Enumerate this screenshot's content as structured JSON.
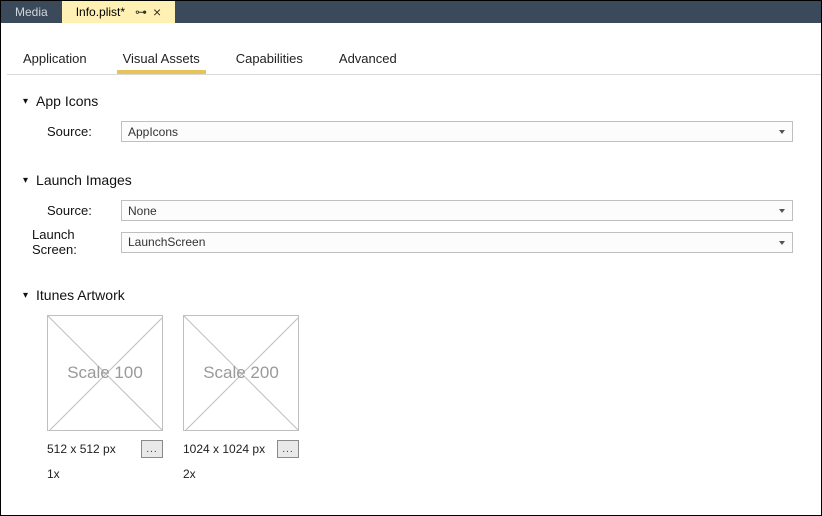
{
  "tabs": {
    "inactive": "Media",
    "active": "Info.plist*"
  },
  "subtabs": {
    "application": "Application",
    "visual_assets": "Visual Assets",
    "capabilities": "Capabilities",
    "advanced": "Advanced"
  },
  "sections": {
    "app_icons": {
      "title": "App Icons",
      "source_label": "Source:",
      "source_value": "AppIcons"
    },
    "launch_images": {
      "title": "Launch Images",
      "source_label": "Source:",
      "source_value": "None",
      "launch_screen_label": "Launch Screen:",
      "launch_screen_value": "LaunchScreen"
    },
    "itunes_artwork": {
      "title": "Itunes Artwork",
      "items": [
        {
          "scale_overlay": "Scale 100",
          "dims": "512 x 512 px",
          "browse_label": "...",
          "scale": "1x"
        },
        {
          "scale_overlay": "Scale 200",
          "dims": "1024 x 1024 px",
          "browse_label": "...",
          "scale": "2x"
        }
      ]
    }
  }
}
